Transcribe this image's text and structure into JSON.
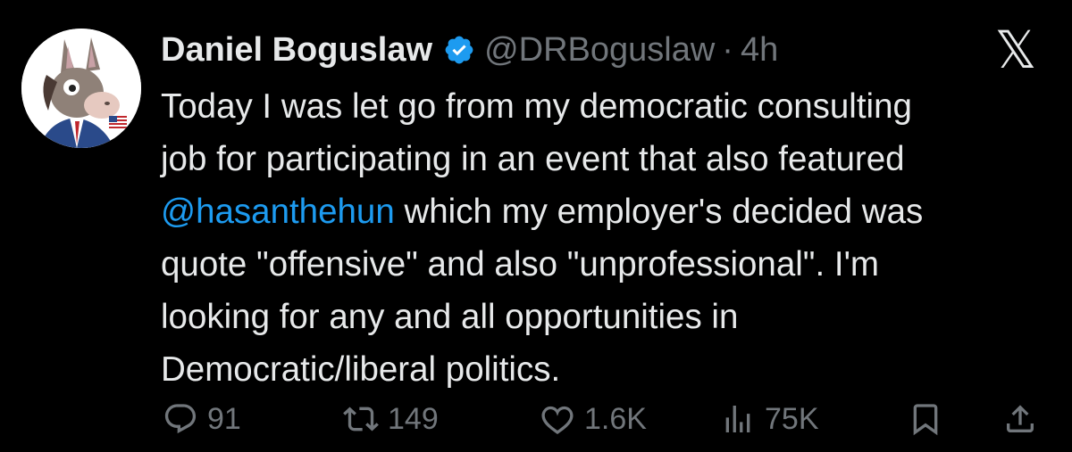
{
  "tweet": {
    "author_name": "Daniel Boguslaw",
    "handle": "@DRBoguslaw",
    "separator": "·",
    "time": "4h",
    "verified_badge_icon": "verified-check-icon",
    "platform_logo_icon": "x-logo-icon",
    "body": {
      "line1": "Today I was let go from my democratic consulting",
      "line2": "job for participating in an event that also featured",
      "line3_mention": "@hasanthehun",
      "line3_rest": " which my employer's decided was",
      "line4": "quote \"offensive\" and also \"unprofessional\". I'm",
      "line5": "looking for any and all opportunities in",
      "line6": "Democratic/liberal politics."
    }
  },
  "metrics": {
    "replies": "91",
    "retweets": "149",
    "likes": "1.6K",
    "views": "75K"
  },
  "icons": {
    "reply": "reply-icon",
    "retweet": "retweet-icon",
    "like": "heart-icon",
    "views": "views-icon",
    "bookmark": "bookmark-icon",
    "share": "share-icon"
  },
  "colors": {
    "background": "#000000",
    "text": "#e7e9ea",
    "secondary_text": "#71767b",
    "link": "#1d9bf0",
    "verified": "#1d9bf0"
  }
}
